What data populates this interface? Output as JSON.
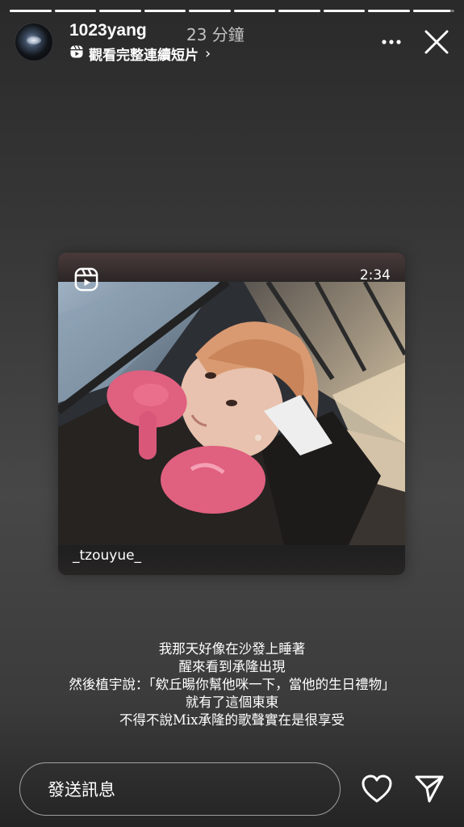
{
  "story": {
    "progress": {
      "segments": [
        1,
        1,
        1,
        1,
        1,
        1,
        1,
        1,
        1,
        0.9
      ]
    },
    "header": {
      "username": "1023yang",
      "time_ago": "23 分鐘",
      "subtitle": "觀看完整連續短片",
      "subtitle_chevron": "›",
      "more_icon": "more-horizontal-icon",
      "close_icon": "close-icon"
    },
    "media_card": {
      "type_icon": "reels-icon",
      "duration": "2:34",
      "handle": "_tzouyue_"
    },
    "caption_lines": [
      "我那天好像在沙發上睡著",
      "醒來看到承隆出現",
      "然後植宇說：「欸丘暘你幫他咪一下，當他的生日禮物」",
      "就有了這個東東",
      "不得不說Mix承隆的歌聲實在是很享受"
    ],
    "footer": {
      "message_placeholder": "發送訊息",
      "like_icon": "heart-icon",
      "share_icon": "send-icon"
    }
  },
  "colors": {
    "text": "#ffffff",
    "pink_pillow": "#e0607f"
  }
}
